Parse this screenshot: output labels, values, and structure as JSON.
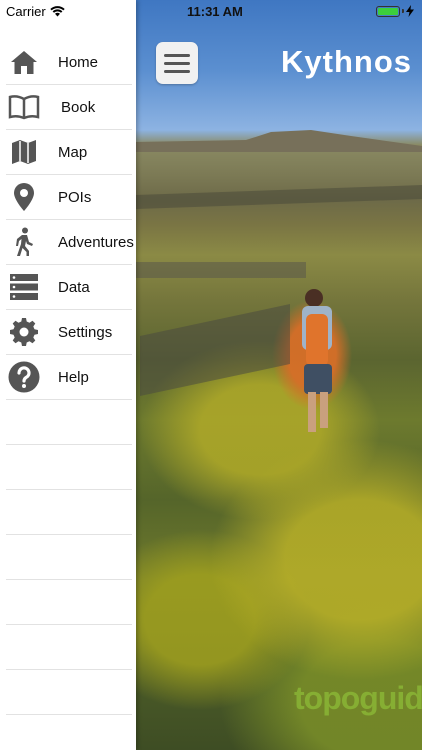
{
  "status_bar": {
    "carrier": "Carrier",
    "time": "11:31 AM",
    "battery_level": 1.0,
    "battery_color": "#3ccf3c"
  },
  "header": {
    "title": "Kythnos",
    "menu_icon": "hamburger-icon"
  },
  "drawer": {
    "items": [
      {
        "label": "Home",
        "icon": "home-icon"
      },
      {
        "label": "Book",
        "icon": "book-icon"
      },
      {
        "label": "Map",
        "icon": "map-icon"
      },
      {
        "label": "POIs",
        "icon": "location-pin-icon"
      },
      {
        "label": "Adventures",
        "icon": "hiker-icon"
      },
      {
        "label": "Data",
        "icon": "server-icon"
      },
      {
        "label": "Settings",
        "icon": "gear-icon"
      },
      {
        "label": "Help",
        "icon": "help-icon"
      }
    ]
  },
  "colors": {
    "icon_gray": "#555555",
    "watermark": "#96cd3c"
  }
}
